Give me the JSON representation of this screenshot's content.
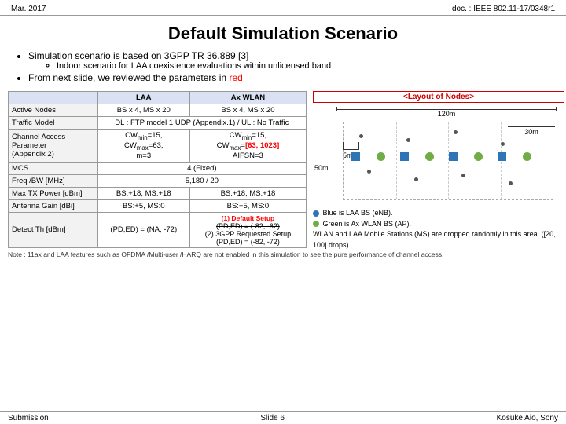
{
  "header": {
    "left": "Mar. 2017",
    "right": "doc. : IEEE 802.11-17/0348r1"
  },
  "main_title": "Default Simulation Scenario",
  "bullets": [
    {
      "text": "Simulation scenario is based on 3GPP TR 36.889 [3]",
      "sub": [
        "Indoor scenario for LAA coexistence evaluations within unlicensed band"
      ]
    },
    {
      "text_before": "From next slide, we reviewed the parameters in ",
      "text_red": "red"
    }
  ],
  "table": {
    "headers": [
      "",
      "LAA",
      "Ax WLAN"
    ],
    "rows": [
      {
        "param": "Active Nodes",
        "laa": "BS x 4, MS x 20",
        "wlan": "BS x 4, MS x 20"
      },
      {
        "param": "Traffic Model",
        "laa": "DL : FTP model 1 UDP (Appendix.1) / UL : No Traffic",
        "wlan": "",
        "merged": true
      },
      {
        "param": "Channel Access Parameter (Appendix 2)",
        "laa": "CWmin=15, CWmax=63, m=3",
        "wlan": "CWmin=15, CWmax=[63, 1023] AIFSN=3",
        "wlan_red": "[63, 1023]"
      },
      {
        "param": "MCS",
        "laa": "4 (Fixed)",
        "wlan": "",
        "merged": true
      },
      {
        "param": "Freq /BW [MHz]",
        "laa": "5,180 / 20",
        "wlan": "",
        "merged": true
      },
      {
        "param": "Max TX Power [dBm]",
        "laa": "BS:+18, MS:+18",
        "wlan": "BS:+18, MS:+18"
      },
      {
        "param": "Antenna Gain [dBi]",
        "laa": "BS:+5, MS:0",
        "wlan": "BS:+5, MS:0"
      },
      {
        "param": "Detect Th [dBm]",
        "laa": "(PD,ED) = (NA, -72)",
        "wlan_line1": "(1) Default Setup",
        "wlan_line2_strike": "(PD,ED) = (-82, -62)",
        "wlan_line3": "(2) 3GPP Requested Setup",
        "wlan_line4": "(PD,ED) = (-82, -72)"
      }
    ]
  },
  "diagram": {
    "title": "<Layout of Nodes>",
    "label_120m": "120m",
    "label_5m": "5m",
    "label_50m": "50m",
    "label_30m": "30m"
  },
  "legend": {
    "items": [
      {
        "color": "blue",
        "text": "Blue is LAA BS (eNB)."
      },
      {
        "color": "green",
        "text": "Green is Ax WLAN BS (AP)."
      },
      {
        "color": null,
        "text": "WLAN and LAA Mobile Stations (MS) are dropped randomly in this area. ([20, 100] drops)"
      }
    ]
  },
  "note": "Note : 11ax and LAA features such as OFDMA /Multi-user /HARQ are not enabled in this simulation to see the pure  performance of channel access.",
  "footer": {
    "left": "Submission",
    "center": "Slide 6",
    "right": "Kosuke Aio, Sony"
  }
}
